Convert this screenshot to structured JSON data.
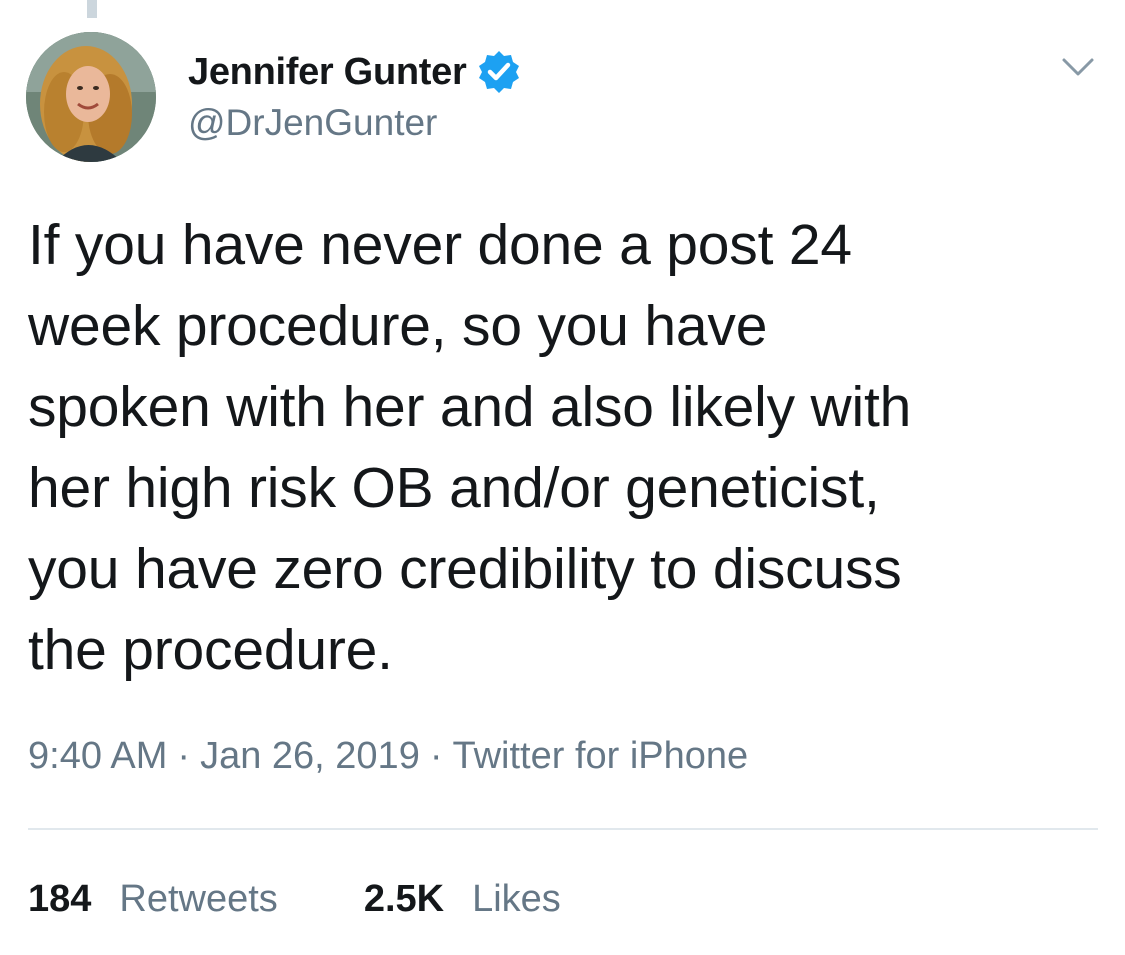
{
  "author": {
    "display_name": "Jennifer Gunter",
    "handle": "@DrJenGunter",
    "verified": true,
    "avatar_icon": "profile-photo"
  },
  "tweet": {
    "text": "If you have never done a post 24\nweek procedure, so you have\nspoken with her and also likely with\nher high risk OB and/or geneticist,\nyou have zero credibility to discuss\nthe procedure."
  },
  "meta": {
    "time": "9:40 AM",
    "separator": "·",
    "date": "Jan 26, 2019",
    "source": "Twitter for iPhone"
  },
  "stats": {
    "retweets_count": "184",
    "retweets_label": "Retweets",
    "likes_count": "2.5K",
    "likes_label": "Likes"
  },
  "icons": {
    "verified": "verified-badge-icon",
    "menu": "chevron-down-icon"
  },
  "colors": {
    "text_primary": "#14171a",
    "text_secondary": "#657786",
    "verified_blue": "#1da1f2",
    "divider": "#e1e8ed"
  }
}
